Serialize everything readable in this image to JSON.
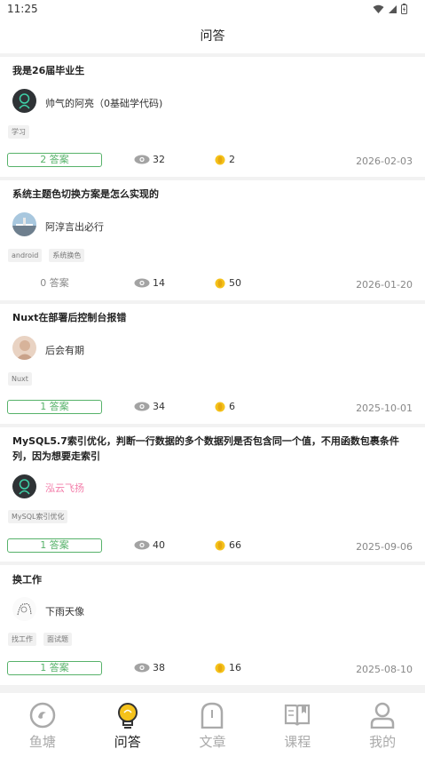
{
  "status": {
    "time": "11:25"
  },
  "header": {
    "title": "问答"
  },
  "questions": [
    {
      "title": "我是26届毕业生",
      "author": "帅气的阿亮（0基础学代码)",
      "tags": [
        "学习"
      ],
      "answers": "2 答案",
      "views": "32",
      "coins": "2",
      "date": "2026-02-03"
    },
    {
      "title": "系统主题色切换方案是怎么实现的",
      "author": "阿淳言出必行",
      "tags": [
        "android",
        "系统换色"
      ],
      "answers": "0 答案",
      "views": "14",
      "coins": "50",
      "date": "2026-01-20"
    },
    {
      "title": "Nuxt在部署后控制台报错",
      "author": "后会有期",
      "tags": [
        "Nuxt"
      ],
      "answers": "1 答案",
      "views": "34",
      "coins": "6",
      "date": "2025-10-01"
    },
    {
      "title": "MySQL5.7索引优化，判断一行数据的多个数据列是否包含同一个值，不用函数包裹条件列，因为想要走索引",
      "author": "泓云飞扬",
      "tags": [
        "MySQL索引优化"
      ],
      "answers": "1 答案",
      "views": "40",
      "coins": "66",
      "date": "2025-09-06"
    },
    {
      "title": "换工作",
      "author": "下雨天像",
      "tags": [
        "找工作",
        "面试题"
      ],
      "answers": "1 答案",
      "views": "38",
      "coins": "16",
      "date": "2025-08-10"
    }
  ],
  "tabs": [
    {
      "label": "鱼塘",
      "icon": "pond-icon"
    },
    {
      "label": "问答",
      "icon": "lightbulb-icon"
    },
    {
      "label": "文章",
      "icon": "article-icon"
    },
    {
      "label": "课程",
      "icon": "book-icon"
    },
    {
      "label": "我的",
      "icon": "user-icon"
    }
  ],
  "colors": {
    "accent": "#57b26a",
    "pink_name": "#f37eaa",
    "coin": "#f5c21b",
    "active_tab": "#f5c21b"
  }
}
